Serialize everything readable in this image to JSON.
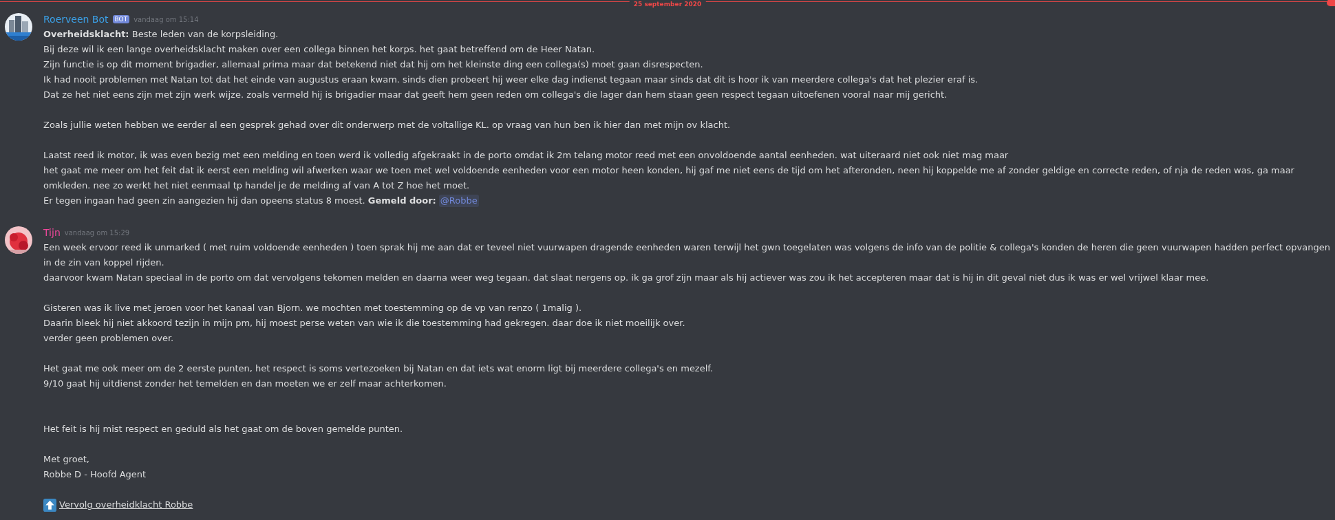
{
  "divider": {
    "date": "25 september 2020",
    "new_marker": true
  },
  "messages": [
    {
      "author": "Roerveen Bot",
      "color": "#3ba0e6",
      "badge": "BOT",
      "timestamp": "vandaag om 15:14",
      "lines": [
        {
          "kind": "text",
          "text": "**Overheidsklacht:** Beste leden van de korpsleiding."
        },
        {
          "kind": "text",
          "text": "Bij deze wil ik een lange overheidsklacht maken over een collega binnen het korps. het gaat betreffend om de Heer Natan."
        },
        {
          "kind": "text",
          "text": "Zijn functie is op dit moment brigadier, allemaal prima maar dat betekend niet dat hij om het kleinste ding een collega(s) moet gaan disrespecten."
        },
        {
          "kind": "text",
          "text": "Ik had nooit problemen met Natan tot dat het einde van augustus eraan kwam. sinds dien probeert hij weer elke dag indienst tegaan maar sinds dat dit is hoor ik van meerdere collega's dat het plezier eraf is."
        },
        {
          "kind": "text",
          "text": "Dat ze het niet eens zijn met zijn werk wijze. zoals vermeld hij is brigadier maar dat geeft hem geen reden om collega's die lager dan hem staan geen respect tegaan uitoefenen vooral naar mij gericht."
        },
        {
          "kind": "blank"
        },
        {
          "kind": "text",
          "text": "Zoals jullie weten hebben we eerder al een gesprek gehad over dit onderwerp met de voltallige KL. op vraag van hun ben ik hier dan met mijn ov klacht."
        },
        {
          "kind": "blank"
        },
        {
          "kind": "text",
          "text": "Laatst reed ik motor, ik was even bezig met een melding en toen werd ik volledig afgekraakt in de porto omdat ik 2m telang motor reed met een onvoldoende aantal eenheden. wat uiteraard niet ook niet mag maar"
        },
        {
          "kind": "text",
          "text": "het gaat me meer om het feit dat ik eerst een melding wil afwerken waar we toen met wel voldoende eenheden voor een motor heen konden, hij gaf me niet eens de tijd om het afteronden, neen hij koppelde me af zonder geldige en correcte reden, of nja de reden was, ga maar"
        },
        {
          "kind": "text",
          "text": "omkleden. nee zo werkt het niet eenmaal tp handel je de melding af van A tot Z hoe het moet."
        },
        {
          "kind": "text",
          "text": "Er tegen ingaan had geen zin aangezien hij dan opeens status 8 moest. **Gemeld door:**",
          "mention": "@Robbe"
        }
      ]
    },
    {
      "author": "Tijn",
      "color": "#f0479b",
      "timestamp": "vandaag om 15:29",
      "lines": [
        {
          "kind": "text",
          "text": "Een week ervoor reed ik unmarked ( met ruim voldoende eenheden ) toen sprak hij me aan dat er teveel niet vuurwapen dragende eenheden waren terwijl het gwn toegelaten was volgens de info van de politie & collega's konden de heren die geen vuurwapen hadden perfect opvangen"
        },
        {
          "kind": "text",
          "text": "in de zin van koppel rijden."
        },
        {
          "kind": "text",
          "text": "daarvoor kwam Natan speciaal in de porto om dat vervolgens tekomen melden en daarna weer weg tegaan. dat slaat nergens op. ik ga grof zijn maar als hij actiever was zou ik het accepteren maar dat is hij in dit geval niet dus ik was er wel vrijwel klaar mee."
        },
        {
          "kind": "blank"
        },
        {
          "kind": "text",
          "text": "Gisteren was ik live met jeroen voor het kanaal van Bjorn. we mochten met toestemming op de vp van renzo ( 1malig )."
        },
        {
          "kind": "text",
          "text": "Daarin bleek hij niet akkoord tezijn in mijn pm, hij moest perse weten van wie ik die toestemming had gekregen.  daar doe ik niet moeilijk over."
        },
        {
          "kind": "text",
          "text": "verder geen problemen over."
        },
        {
          "kind": "blank"
        },
        {
          "kind": "text",
          "text": "Het gaat me ook meer om de 2 eerste punten, het respect is soms vertezoeken bij Natan en dat iets wat enorm ligt bij meerdere collega's en mezelf."
        },
        {
          "kind": "text",
          "text": "9/10 gaat hij uitdienst zonder het temelden en dan moeten we er zelf maar achterkomen."
        },
        {
          "kind": "blank"
        },
        {
          "kind": "blank"
        },
        {
          "kind": "text",
          "text": "Het feit is hij mist respect en geduld als het gaat om de boven gemelde punten."
        },
        {
          "kind": "blank"
        },
        {
          "kind": "text",
          "text": "Met groet,"
        },
        {
          "kind": "text",
          "text": "Robbe D - Hoofd Agent"
        },
        {
          "kind": "blank"
        },
        {
          "kind": "link",
          "text": "Vervolg overheidklacht Robbe"
        }
      ]
    }
  ]
}
